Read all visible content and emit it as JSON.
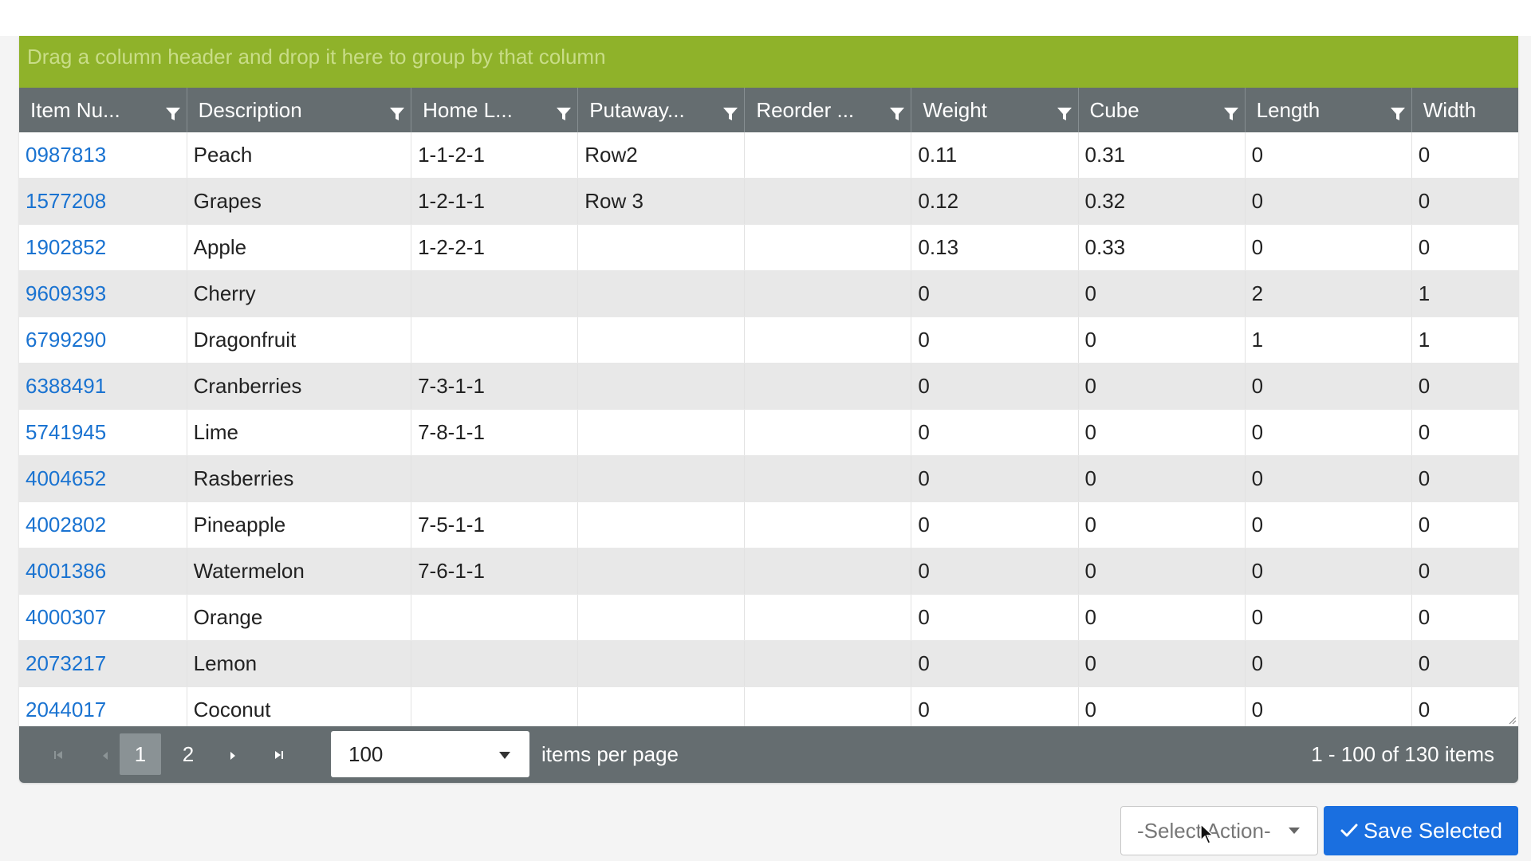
{
  "group_bar": {
    "text": "Drag a column header and drop it here to group by that column"
  },
  "columns": [
    "Item Nu...",
    "Description",
    "Home L...",
    "Putaway...",
    "Reorder ...",
    "Weight",
    "Cube",
    "Length",
    "Width"
  ],
  "rows": [
    [
      "0987813",
      "Peach",
      "1-1-2-1",
      "Row2",
      "",
      "0.11",
      "0.31",
      "0",
      "0"
    ],
    [
      "1577208",
      "Grapes",
      "1-2-1-1",
      "Row 3",
      "",
      "0.12",
      "0.32",
      "0",
      "0"
    ],
    [
      "1902852",
      "Apple",
      "1-2-2-1",
      "",
      "",
      "0.13",
      "0.33",
      "0",
      "0"
    ],
    [
      "9609393",
      "Cherry",
      "",
      "",
      "",
      "0",
      "0",
      "2",
      "1"
    ],
    [
      "6799290",
      "Dragonfruit",
      "",
      "",
      "",
      "0",
      "0",
      "1",
      "1"
    ],
    [
      "6388491",
      "Cranberries",
      "7-3-1-1",
      "",
      "",
      "0",
      "0",
      "0",
      "0"
    ],
    [
      "5741945",
      "Lime",
      "7-8-1-1",
      "",
      "",
      "0",
      "0",
      "0",
      "0"
    ],
    [
      "4004652",
      "Rasberries",
      "",
      "",
      "",
      "0",
      "0",
      "0",
      "0"
    ],
    [
      "4002802",
      "Pineapple",
      "7-5-1-1",
      "",
      "",
      "0",
      "0",
      "0",
      "0"
    ],
    [
      "4001386",
      "Watermelon",
      "7-6-1-1",
      "",
      "",
      "0",
      "0",
      "0",
      "0"
    ],
    [
      "4000307",
      "Orange",
      "",
      "",
      "",
      "0",
      "0",
      "0",
      "0"
    ],
    [
      "2073217",
      "Lemon",
      "",
      "",
      "",
      "0",
      "0",
      "0",
      "0"
    ],
    [
      "2044017",
      "Coconut",
      "",
      "",
      "",
      "0",
      "0",
      "0",
      "0"
    ]
  ],
  "pager": {
    "first_icon": "first-page-icon",
    "prev_icon": "prev-page-icon",
    "pages": [
      "1",
      "2"
    ],
    "current_page": "1",
    "next_icon": "next-page-icon",
    "last_icon": "last-page-icon",
    "page_size": "100",
    "items_per_page_label": "items per page",
    "info": "1 - 100 of 130 items"
  },
  "actions": {
    "select_action": "-Select Action-",
    "save_selected": "Save Selected"
  },
  "colors": {
    "group_bar": "#8fb22a",
    "header": "#656d70",
    "link": "#1a73d1",
    "primary_button": "#1a6fe0"
  }
}
